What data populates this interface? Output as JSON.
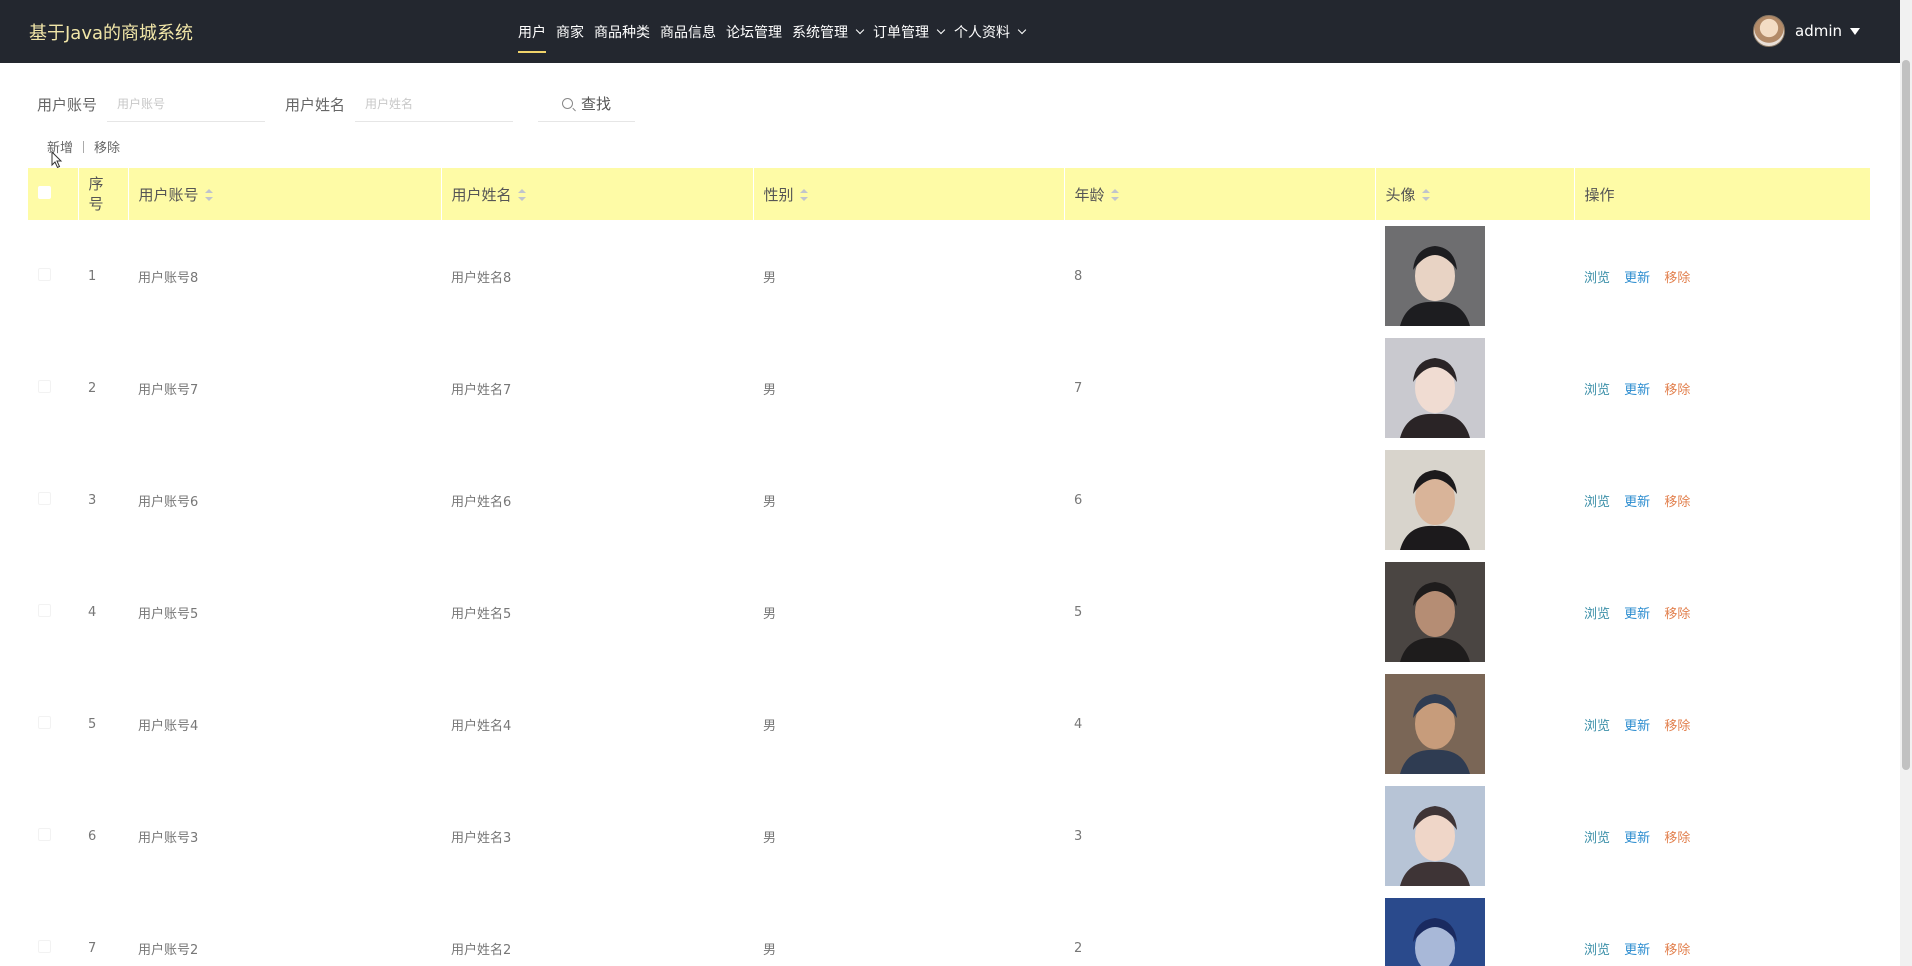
{
  "header": {
    "app_title": "基于Java的商城系统",
    "nav": [
      {
        "label": "用户",
        "active": true,
        "dropdown": false
      },
      {
        "label": "商家",
        "active": false,
        "dropdown": false
      },
      {
        "label": "商品种类",
        "active": false,
        "dropdown": false
      },
      {
        "label": "商品信息",
        "active": false,
        "dropdown": false
      },
      {
        "label": "论坛管理",
        "active": false,
        "dropdown": false
      },
      {
        "label": "系统管理",
        "active": false,
        "dropdown": true
      },
      {
        "label": "订单管理",
        "active": false,
        "dropdown": true
      },
      {
        "label": "个人资料",
        "active": false,
        "dropdown": true
      }
    ],
    "user": {
      "name": "admin"
    }
  },
  "search": {
    "account_label": "用户账号",
    "account_placeholder": "用户账号",
    "name_label": "用户姓名",
    "name_placeholder": "用户姓名",
    "button_label": "查找"
  },
  "actions": {
    "add_label": "新增",
    "remove_label": "移除"
  },
  "table": {
    "headers": {
      "index": "序号",
      "account": "用户账号",
      "name": "用户姓名",
      "gender": "性别",
      "age": "年龄",
      "avatar": "头像",
      "ops": "操作"
    },
    "op_labels": {
      "view": "浏览",
      "update": "更新",
      "remove": "移除"
    },
    "rows": [
      {
        "index": "1",
        "account": "用户账号8",
        "name": "用户姓名8",
        "gender": "男",
        "age": "8"
      },
      {
        "index": "2",
        "account": "用户账号7",
        "name": "用户姓名7",
        "gender": "男",
        "age": "7"
      },
      {
        "index": "3",
        "account": "用户账号6",
        "name": "用户姓名6",
        "gender": "男",
        "age": "6"
      },
      {
        "index": "4",
        "account": "用户账号5",
        "name": "用户姓名5",
        "gender": "男",
        "age": "5"
      },
      {
        "index": "5",
        "account": "用户账号4",
        "name": "用户姓名4",
        "gender": "男",
        "age": "4"
      },
      {
        "index": "6",
        "account": "用户账号3",
        "name": "用户姓名3",
        "gender": "男",
        "age": "3"
      },
      {
        "index": "7",
        "account": "用户账号2",
        "name": "用户姓名2",
        "gender": "男",
        "age": "2"
      }
    ]
  },
  "colors": {
    "header_bg": "#23272f",
    "title": "#f1e6a8",
    "table_header_bg": "#fefba6",
    "view": "#3b8fa8",
    "update": "#2b8ccf",
    "remove": "#e2814f"
  }
}
